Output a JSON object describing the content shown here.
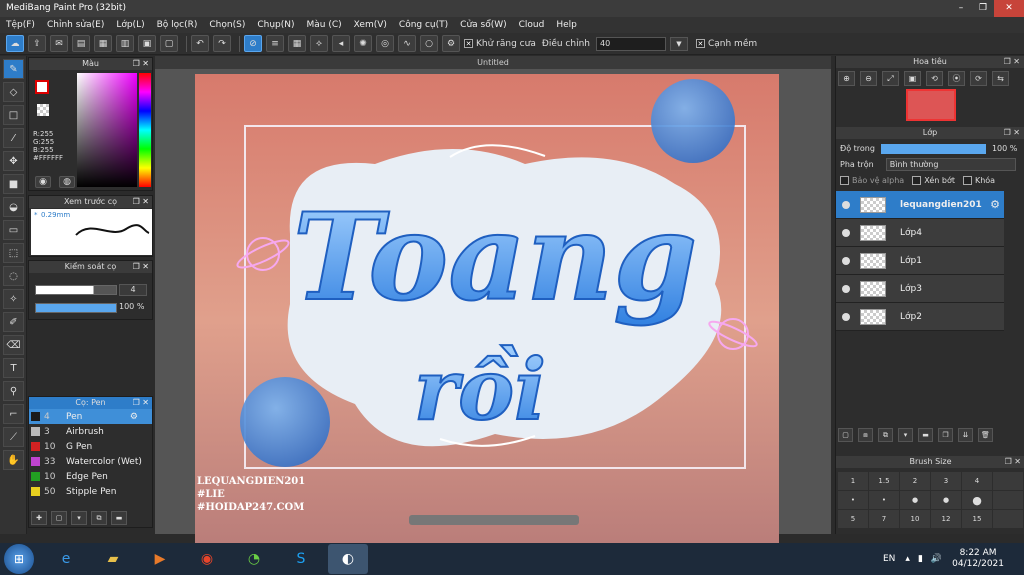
{
  "app": {
    "title": "MediBang Paint Pro (32bit)"
  },
  "menu": [
    "Tệp(F)",
    "Chỉnh sửa(E)",
    "Lớp(L)",
    "Bộ lọc(R)",
    "Chọn(S)",
    "Chụp(N)",
    "Màu (C)",
    "Xem(V)",
    "Công cụ(T)",
    "Cửa sổ(W)",
    "Cloud",
    "Help"
  ],
  "toolbar": {
    "antialias_label": "Khử răng cưa",
    "correction_label": "Điều chỉnh",
    "correction_value": "40",
    "sharp_label": "Cạnh mềm"
  },
  "colorpanel": {
    "title": "Màu",
    "r": "R:255",
    "g": "G:255",
    "b": "B:255",
    "hex": "#FFFFFF"
  },
  "preview": {
    "title": "Xem trước cọ",
    "size": "0.29mm"
  },
  "control": {
    "title": "Kiểm soát cọ",
    "size_value": "4",
    "opacity_value": "100 %",
    "size_fraction": 0.72,
    "opacity_fraction": 1.0
  },
  "brushpanel": {
    "title": "Cọ: Pen",
    "brushes": [
      {
        "size": "4",
        "name": "Pen",
        "color": "#1a1a1a",
        "selected": true
      },
      {
        "size": "3",
        "name": "Airbrush",
        "color": "#bbbbbb",
        "selected": false
      },
      {
        "size": "10",
        "name": "G Pen",
        "color": "#d32222",
        "selected": false
      },
      {
        "size": "33",
        "name": "Watercolor (Wet)",
        "color": "#c044d0",
        "selected": false
      },
      {
        "size": "10",
        "name": "Edge Pen",
        "color": "#22a022",
        "selected": false
      },
      {
        "size": "50",
        "name": "Stipple Pen",
        "color": "#e8d020",
        "selected": false
      }
    ]
  },
  "canvas": {
    "tab": "Untitled",
    "art_word1": "Toang",
    "art_word2": "rồi",
    "watermark": [
      "LEQUANGDIEN201",
      "#LIE",
      "#HOIDAP247.COM"
    ]
  },
  "navigator": {
    "title": "Hoa tiêu"
  },
  "layers": {
    "title": "Lớp",
    "opacity_label": "Độ trong",
    "opacity_value": "100 %",
    "opacity_fraction": 1.0,
    "blend_label": "Pha trộn",
    "blend_value": "Bình thường",
    "protect_alpha": "Bảo vệ alpha",
    "clipping": "Xén bớt",
    "lock": "Khóa",
    "list": [
      {
        "name": "lequangdien201",
        "selected": true
      },
      {
        "name": "Lớp4",
        "selected": false
      },
      {
        "name": "Lớp1",
        "selected": false
      },
      {
        "name": "Lớp3",
        "selected": false
      },
      {
        "name": "Lớp2",
        "selected": false
      }
    ]
  },
  "brushsize": {
    "title": "Brush Size",
    "row1": [
      "1",
      "1.5",
      "2",
      "3",
      "4",
      ""
    ],
    "row3": [
      "5",
      "7",
      "10",
      "12",
      "15",
      ""
    ]
  },
  "taskbar": {
    "lang": "EN",
    "time": "8:22 AM",
    "date": "04/12/2021"
  }
}
